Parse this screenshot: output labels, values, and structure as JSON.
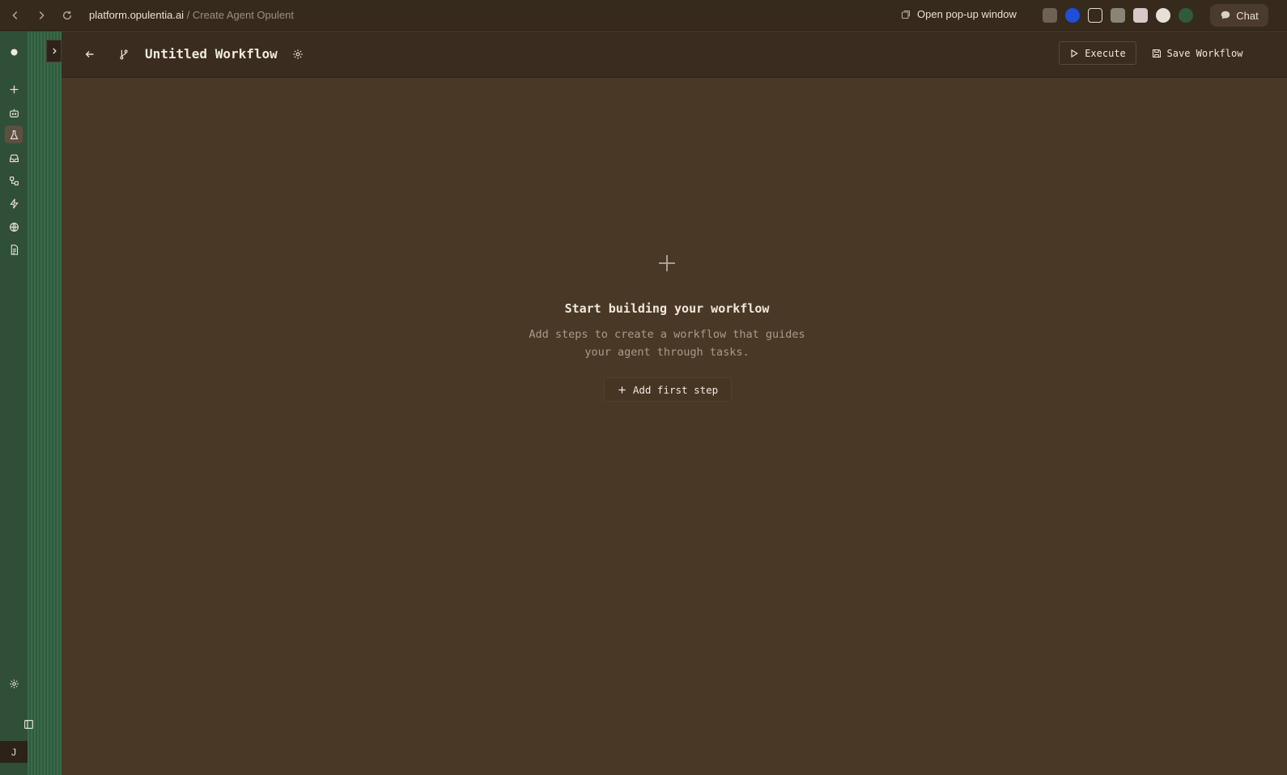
{
  "browser": {
    "url_host": "platform.opulentia.ai",
    "url_path": " / Create Agent Opulent",
    "popup_label": "Open pop-up window",
    "chat_label": "Chat"
  },
  "sidebar": {
    "avatar_letter": "J"
  },
  "header": {
    "title": "Untitled Workflow",
    "execute_label": "Execute",
    "save_label": "Save Workflow"
  },
  "empty_state": {
    "title": "Start building your workflow",
    "description_line1": "Add steps to create a workflow that guides",
    "description_line2": "your agent through tasks.",
    "add_step_label": "Add first step"
  },
  "colors": {
    "background": "#4a3826",
    "header": "#3a2c1f",
    "accent_green": "#2f5a3e"
  }
}
